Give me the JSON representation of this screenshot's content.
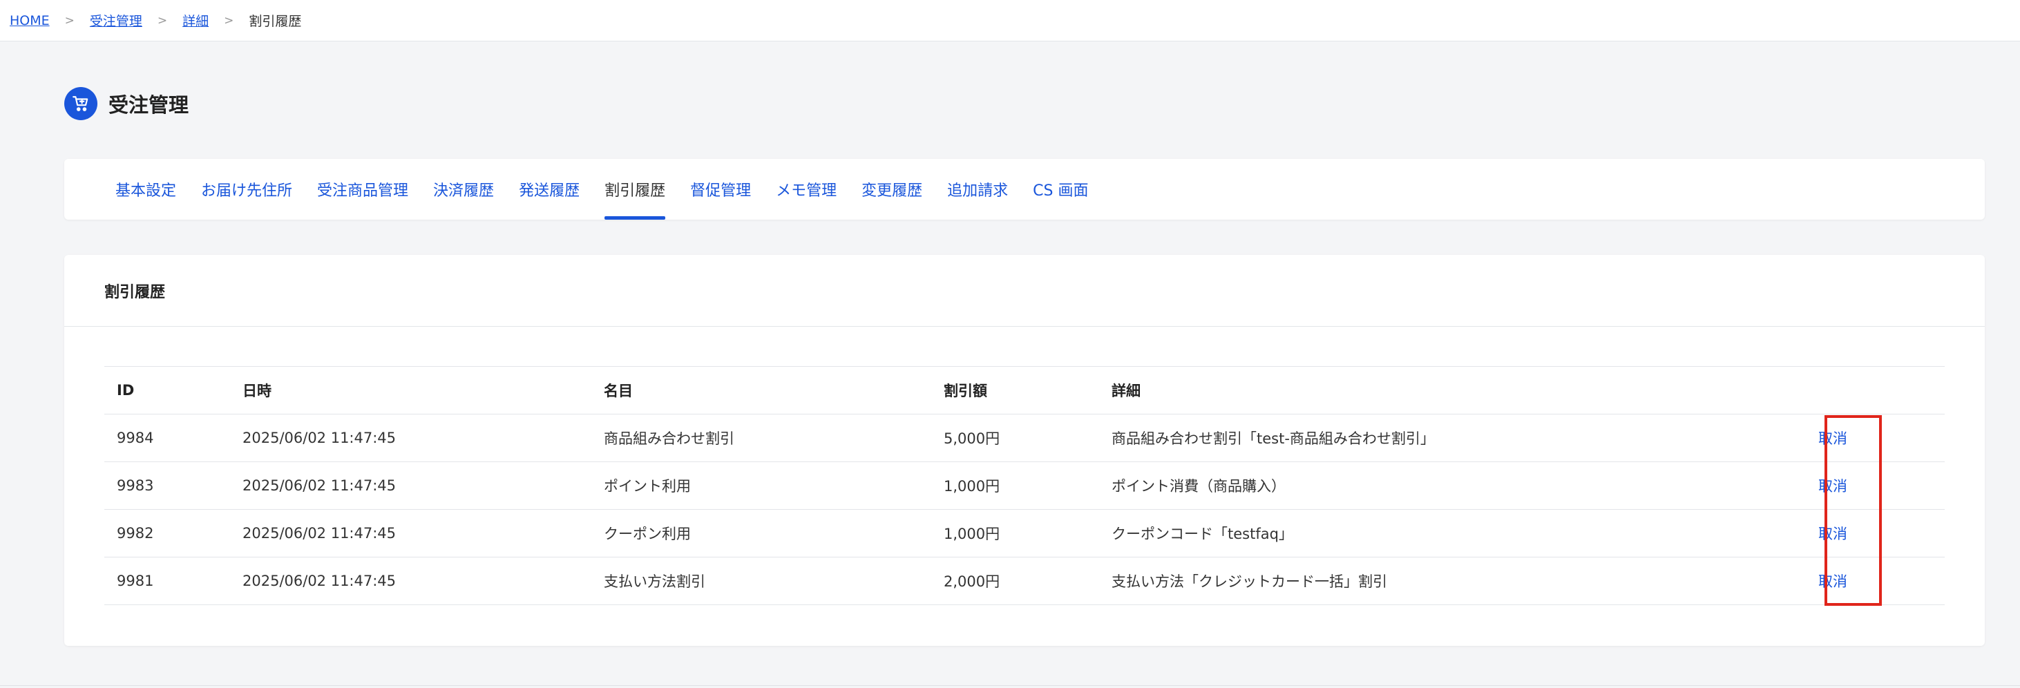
{
  "breadcrumb": {
    "items": [
      "HOME",
      "受注管理",
      "詳細"
    ],
    "current": "割引履歴",
    "separator": ">"
  },
  "page": {
    "title": "受注管理",
    "icon": "cart-icon"
  },
  "tabs": [
    {
      "label": "基本設定"
    },
    {
      "label": "お届け先住所"
    },
    {
      "label": "受注商品管理"
    },
    {
      "label": "決済履歴"
    },
    {
      "label": "発送履歴"
    },
    {
      "label": "割引履歴",
      "active": true
    },
    {
      "label": "督促管理"
    },
    {
      "label": "メモ管理"
    },
    {
      "label": "変更履歴"
    },
    {
      "label": "追加請求"
    },
    {
      "label": "CS 画面"
    }
  ],
  "section": {
    "title": "割引履歴"
  },
  "table": {
    "headers": [
      "ID",
      "日時",
      "名目",
      "割引額",
      "詳細",
      ""
    ],
    "rows": [
      {
        "id": "9984",
        "datetime": "2025/06/02 11:47:45",
        "name": "商品組み合わせ割引",
        "amount": "5,000円",
        "detail": "商品組み合わせ割引「test-商品組み合わせ割引」",
        "action": "取消"
      },
      {
        "id": "9983",
        "datetime": "2025/06/02 11:47:45",
        "name": "ポイント利用",
        "amount": "1,000円",
        "detail": "ポイント消費（商品購入）",
        "action": "取消"
      },
      {
        "id": "9982",
        "datetime": "2025/06/02 11:47:45",
        "name": "クーポン利用",
        "amount": "1,000円",
        "detail": "クーポンコード「testfaq」",
        "action": "取消"
      },
      {
        "id": "9981",
        "datetime": "2025/06/02 11:47:45",
        "name": "支払い方法割引",
        "amount": "2,000円",
        "detail": "支払い方法「クレジットカード一括」割引",
        "action": "取消"
      }
    ]
  },
  "colors": {
    "accent": "#1a56db",
    "highlight": "#e0251b",
    "background": "#f4f5f7"
  }
}
